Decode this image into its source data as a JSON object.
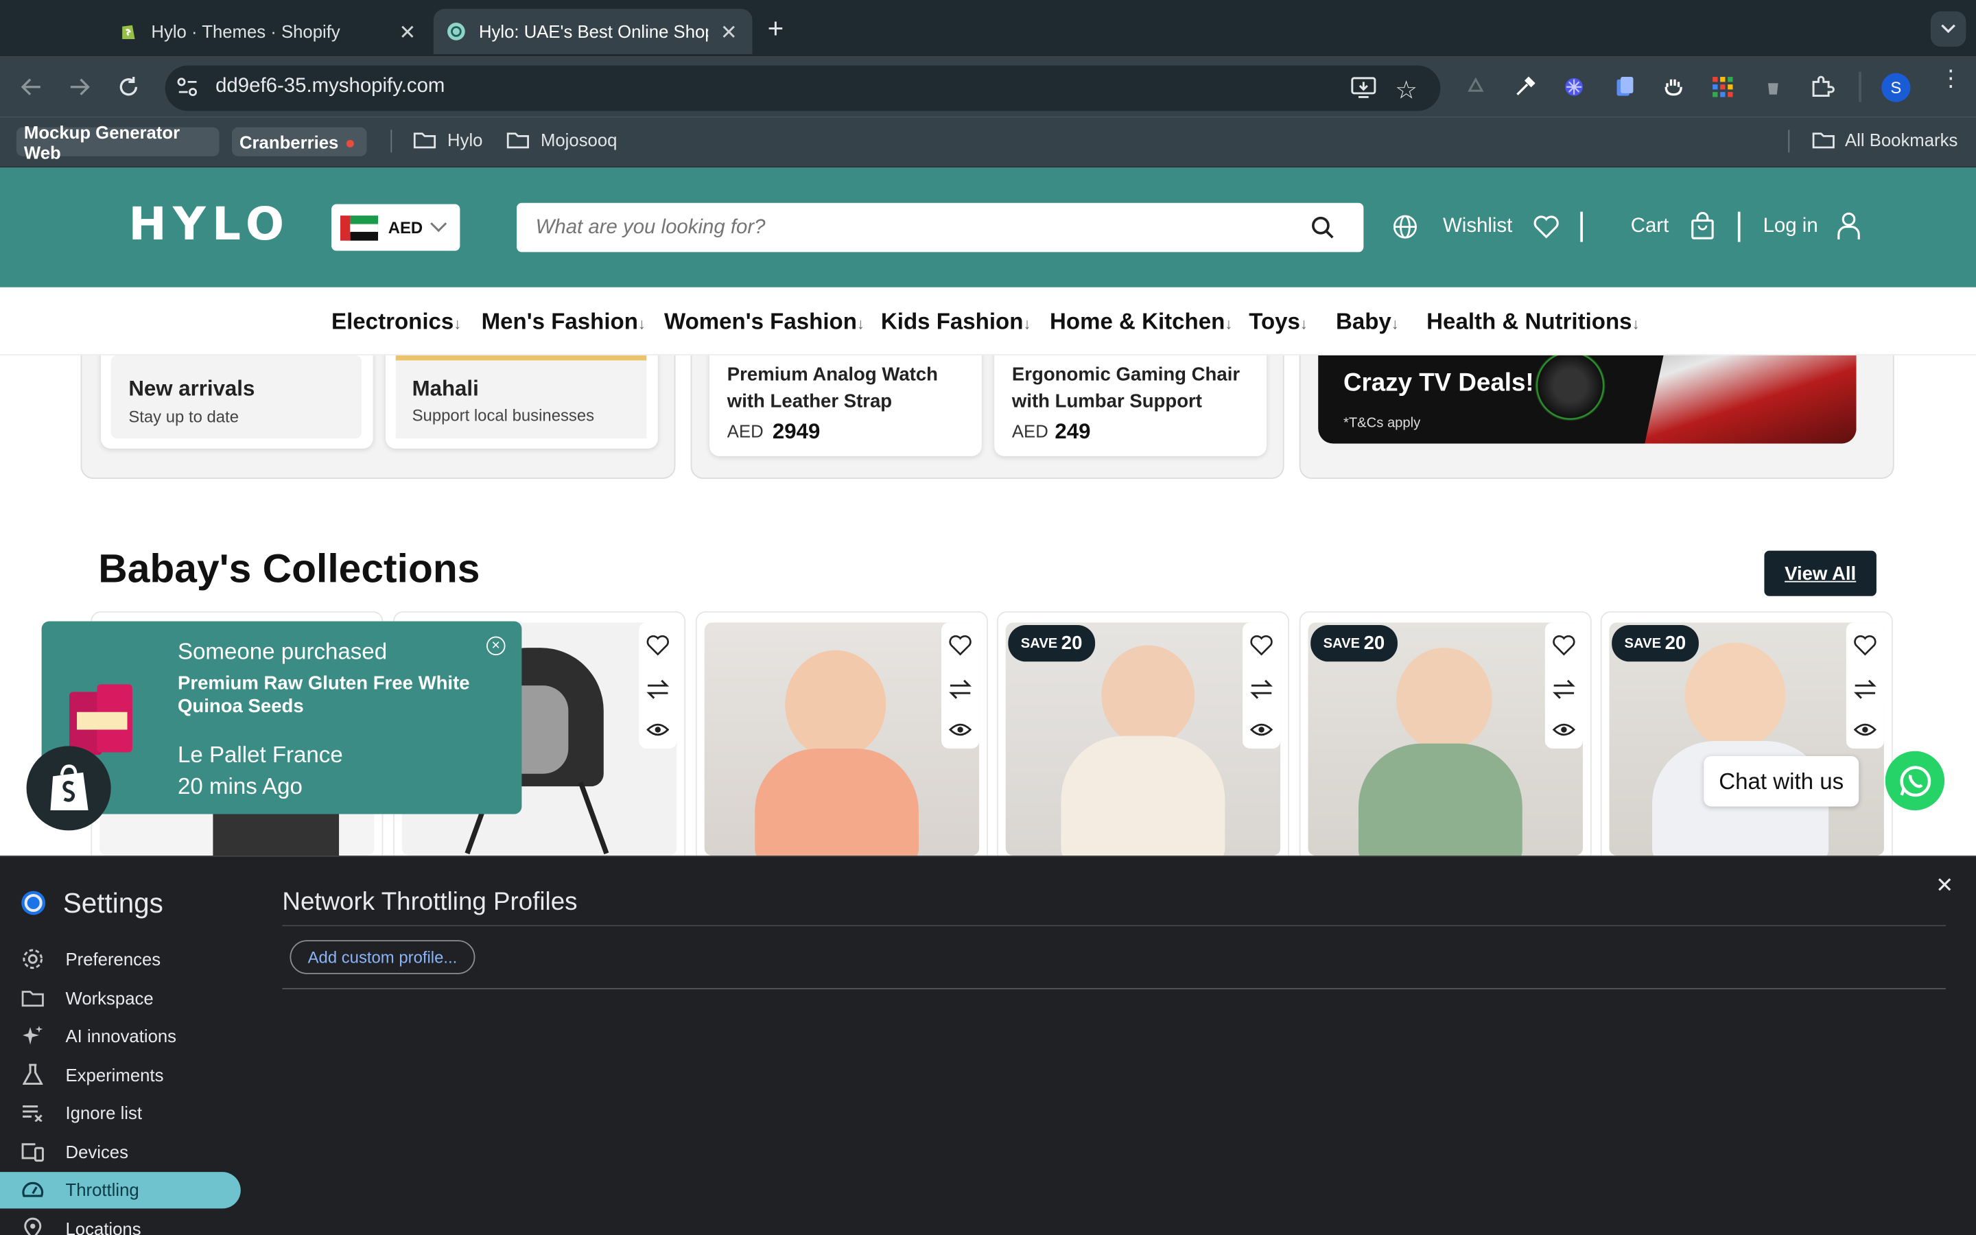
{
  "browser": {
    "tabs": [
      {
        "title": "Hylo · Themes · Shopify"
      },
      {
        "title": "Hylo: UAE's Best Online Shop"
      }
    ],
    "url": "dd9ef6-35.myshopify.com",
    "profile_initial": "S",
    "bookmarks": [
      "Mockup Generator Web",
      "Cranberries",
      "Hylo",
      "Mojosooq"
    ],
    "all_bookmarks": "All Bookmarks"
  },
  "store": {
    "logo": "HYLO",
    "currency": "AED",
    "search_placeholder": "What are you looking for?",
    "wishlist": "Wishlist",
    "cart": "Cart",
    "login": "Log in",
    "nav": [
      "Electronics",
      "Men's Fashion",
      "Women's Fashion",
      "Kids Fashion",
      "Home & Kitchen",
      "Toys",
      "Baby",
      "Health & Nutritions"
    ],
    "promo_cards": [
      {
        "title": "New arrivals",
        "subtitle": "Stay up to date"
      },
      {
        "title": "Mahali",
        "subtitle": "Support local businesses"
      }
    ],
    "deal_products": [
      {
        "title": "Premium Analog Watch with Leather Strap",
        "currency": "AED",
        "price": "2949"
      },
      {
        "title": "Ergonomic Gaming Chair with Lumbar Support",
        "currency": "AED",
        "price": "249"
      }
    ],
    "banner": {
      "headline": "Crazy TV Deals!",
      "note": "*T&Cs apply"
    },
    "collection": {
      "title": "Babay's Collections",
      "view_all": "View All",
      "products": [
        {
          "badge": "",
          "badge_value": ""
        },
        {
          "badge": "",
          "badge_value": ""
        },
        {
          "badge": "",
          "badge_value": ""
        },
        {
          "badge": "SAVE",
          "badge_value": "20"
        },
        {
          "badge": "SAVE",
          "badge_value": "20"
        },
        {
          "badge": "SAVE",
          "badge_value": "20"
        }
      ]
    },
    "popup": {
      "heading": "Someone purchased",
      "product": "Premium Raw Gluten Free White Quinoa Seeds",
      "location": "Le Pallet France",
      "time": "20 mins Ago"
    },
    "chat": "Chat with us"
  },
  "devtools": {
    "title": "Settings",
    "menu": [
      "Preferences",
      "Workspace",
      "AI innovations",
      "Experiments",
      "Ignore list",
      "Devices",
      "Throttling",
      "Locations"
    ],
    "active": "Throttling",
    "section_title": "Network Throttling Profiles",
    "add_button": "Add custom profile..."
  },
  "colors": {
    "brand": "#3a8c84",
    "chrome_dark": "#35424a",
    "devtools_bg": "#202124",
    "selected": "#6fc3cf"
  }
}
